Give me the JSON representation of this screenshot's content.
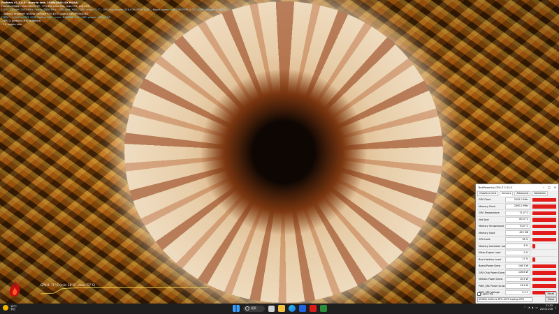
{
  "furmark": {
    "line1": "FurMark v2.3.0.0 - Burn-in test, 2560x1440 (0X MSAA)",
    "line2": "Frames:69184 - time:00:05:59 - FPS:192 (min:154, max:193, avg:193)",
    "line3": "[ GPU 2 ] core: 2055 MHz - mem: 2000 MHz - GPU load: 98% - GPU temp: 71°C - GPU chip power: 126.6 W (PPW: 1.52) - Board power: 146.3 W (PPW: 1.32) - GPU voltage: 0.860 V",
    "line4": "- OpenGL renderer: NVIDIA GeForce RTX 4070 Laptop GPU/PCIe/SSE2",
    "line5": "[ GPU 1 ] GeForce RTX 4070 Laptop GPU - mem: 8188MB - 0% - GPU power: 100% TDP",
    "line6": "- GPU 2 (Intel(R) UHD Graphics)",
    "line7": "- F1: toggle help",
    "graph_label": "GPU 0: 71° C (min: 38° C - max: 72° C)"
  },
  "gpuz": {
    "title": "TechPowerUp GPU-Z 2.53.0",
    "tabs": [
      "Graphics Card",
      "Sensors",
      "Advanced",
      "Validation"
    ],
    "rows": [
      {
        "label": "GPU Clock",
        "value": "2055.0 MHz",
        "fill": 1.0
      },
      {
        "label": "Memory Clock",
        "value": "2000.2 MHz",
        "fill": 1.0
      },
      {
        "label": "GPU Temperature",
        "value": "71.0 °C",
        "fill": 1.0
      },
      {
        "label": "Hot Spot",
        "value": "80.3 °C",
        "fill": 1.0
      },
      {
        "label": "Memory Temperature",
        "value": "70.0 °C",
        "fill": 1.0
      },
      {
        "label": "Memory Used",
        "value": "453 MB",
        "fill": 1.0
      },
      {
        "label": "GPU Load",
        "value": "98 %",
        "fill": 1.0
      },
      {
        "label": "Memory Controller Load",
        "value": "8 %",
        "fill": 0.1
      },
      {
        "label": "Video Engine Load",
        "value": "0 %",
        "fill": 0.0
      },
      {
        "label": "Bus Interface Load",
        "value": "17 %",
        "fill": 0.1
      },
      {
        "label": "Board Power Draw",
        "value": "146.3 W",
        "fill": 1.0
      },
      {
        "label": "GPU Chip Power Draw",
        "value": "126.6 W",
        "fill": 1.0
      },
      {
        "label": "MVDDC Power Draw",
        "value": "10.5 W",
        "fill": 1.0
      },
      {
        "label": "PWR_SRC Power Draw",
        "value": "13.5 W",
        "fill": 1.0
      },
      {
        "label": "PWR_SRC Voltage",
        "value": "9.4 V",
        "fill": 1.0
      }
    ],
    "log_label": "Log to file",
    "reset_label": "Reset",
    "device": "NVIDIA GeForce RTX 4070 Laptop GPU",
    "close_label": "Close"
  },
  "taskbar": {
    "weather_temp": "18°C",
    "weather_desc": "多云",
    "search_label": "搜索",
    "time": "21:52",
    "date": "2023/1/28"
  }
}
